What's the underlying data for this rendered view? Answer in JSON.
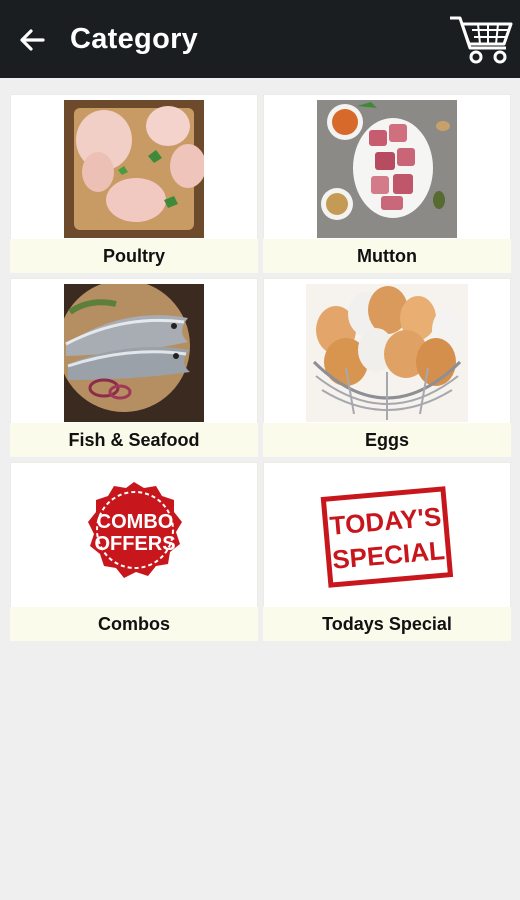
{
  "appbar": {
    "title": "Category",
    "back_icon": "arrow-left-icon",
    "cart_icon": "shopping-cart-icon",
    "background": "#1b1e20"
  },
  "categories": [
    {
      "label": "Poultry",
      "image": "raw-chicken-pieces"
    },
    {
      "label": "Mutton",
      "image": "raw-mutton-pieces"
    },
    {
      "label": "Fish & Seafood",
      "image": "whole-fish-on-board"
    },
    {
      "label": "Eggs",
      "image": "eggs-in-wire-basket"
    },
    {
      "label": "Combos",
      "image": "combo-offers-badge",
      "badge_text": [
        "COMBO",
        "OFFERS"
      ]
    },
    {
      "label": "Todays Special",
      "image": "todays-special-stamp",
      "stamp_text": [
        "TODAY'S",
        "SPECIAL"
      ]
    }
  ],
  "colors": {
    "label_bar": "#fafbea",
    "page_background": "#efefef",
    "badge_red": "#c8161d"
  }
}
